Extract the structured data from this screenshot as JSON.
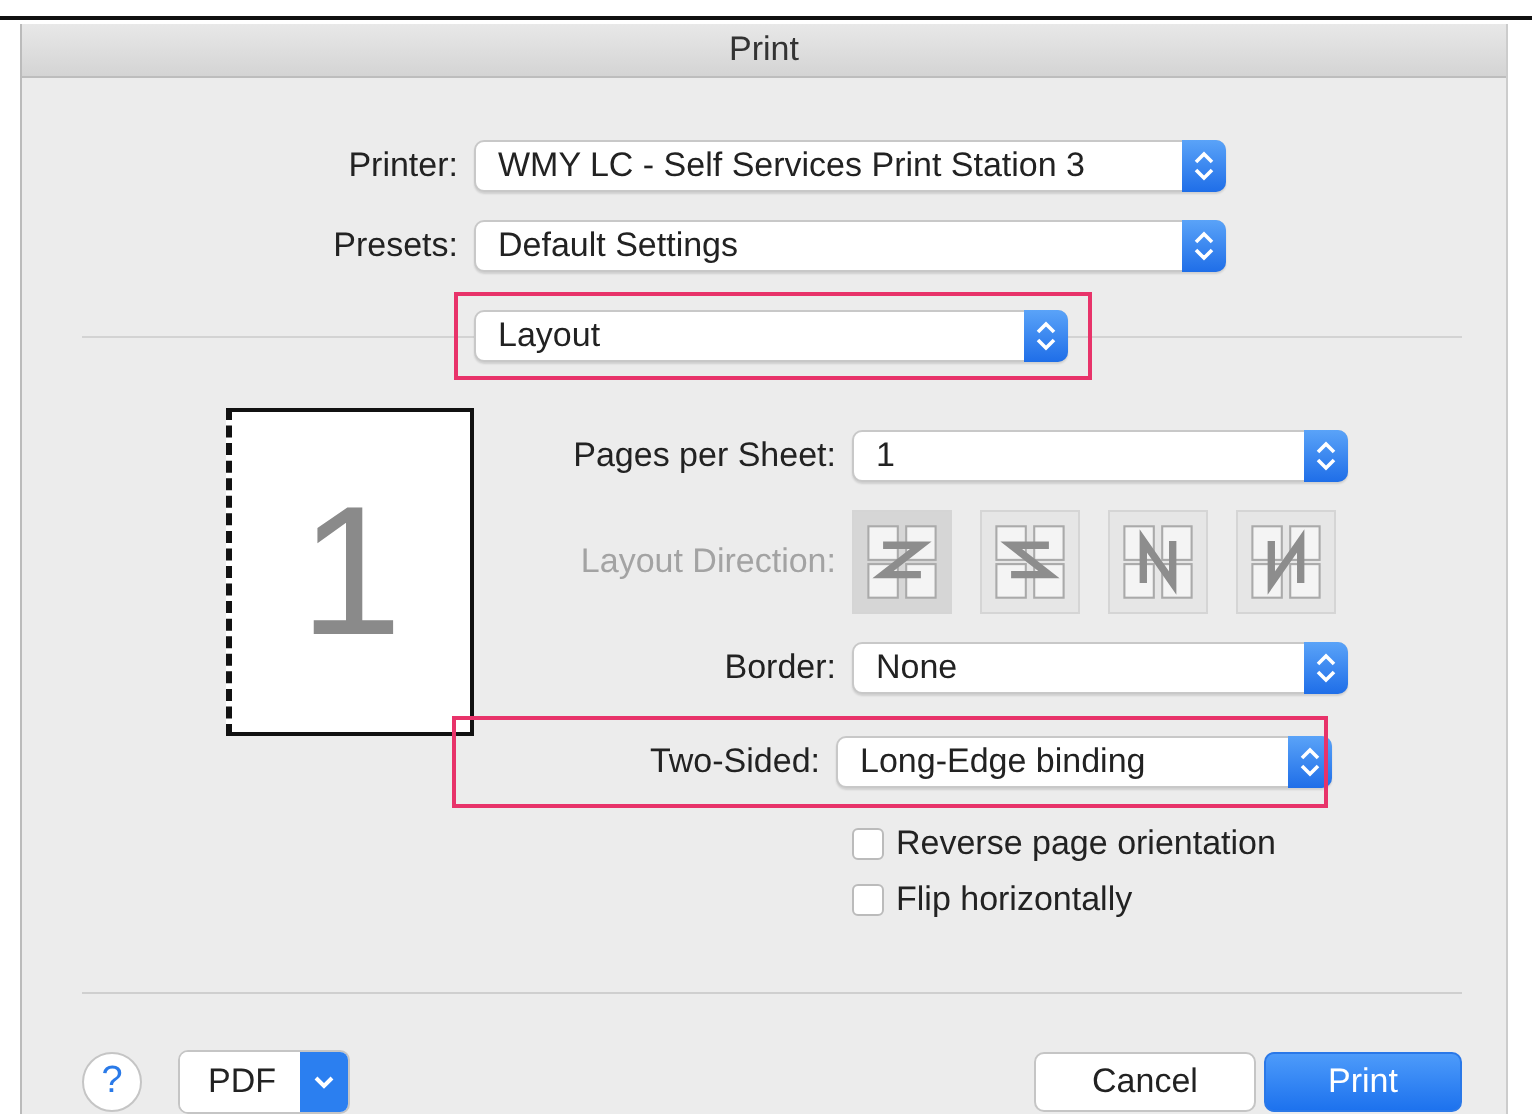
{
  "window": {
    "title": "Print"
  },
  "printer_fields": [
    {
      "label": "Printer:",
      "value": "WMY LC - Self Services Print Station 3"
    },
    {
      "label": "Presets:",
      "value": "Default Settings"
    }
  ],
  "section_popup": {
    "value": "Layout",
    "highlighted": true
  },
  "preview": {
    "page_number": "1"
  },
  "layout_fields": [
    {
      "kind": "popup",
      "label": "Pages per Sheet:",
      "value": "1",
      "highlighted": false
    },
    {
      "kind": "direction",
      "label": "Layout Direction:",
      "disabled": true,
      "options": [
        {
          "kind": "z",
          "selected": true
        },
        {
          "kind": "s",
          "selected": false
        },
        {
          "kind": "n-reverse",
          "selected": false
        },
        {
          "kind": "n",
          "selected": false
        }
      ]
    },
    {
      "kind": "popup",
      "label": "Border:",
      "value": "None",
      "highlighted": false
    },
    {
      "kind": "popup",
      "label": "Two-Sided:",
      "value": "Long-Edge binding",
      "highlighted": true
    }
  ],
  "checkboxes": [
    {
      "label": "Reverse page orientation",
      "checked": false
    },
    {
      "label": "Flip horizontally",
      "checked": false
    }
  ],
  "footer": {
    "help": "?",
    "pdf": "PDF",
    "cancel": "Cancel",
    "print": "Print"
  }
}
